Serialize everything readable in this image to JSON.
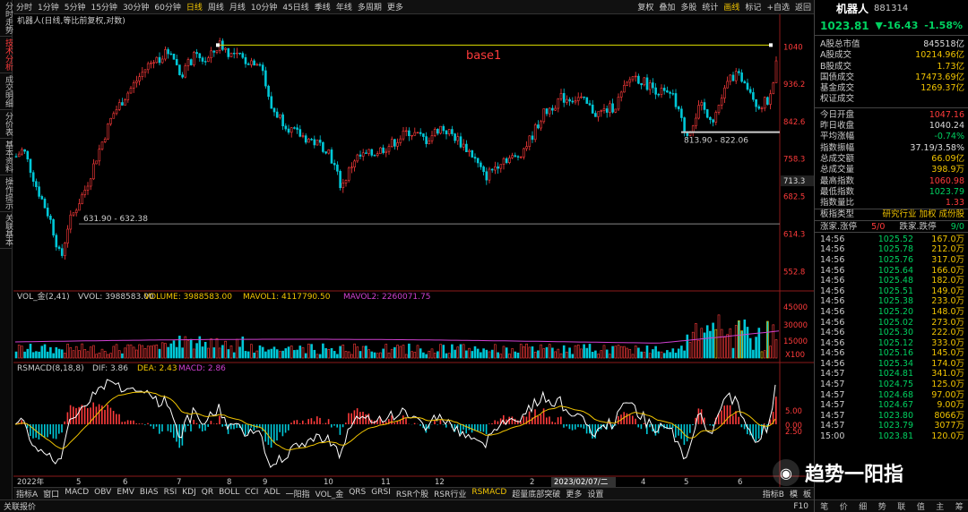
{
  "left_nav": [
    {
      "label": "分时走势",
      "active": false
    },
    {
      "label": "技术分析",
      "active": true
    },
    {
      "label": "成交明细",
      "active": false
    },
    {
      "label": "分价表",
      "active": false
    },
    {
      "label": "基本资料",
      "active": false
    },
    {
      "label": "操作提示",
      "active": false
    },
    {
      "label": "关联基本",
      "active": false
    }
  ],
  "periods": [
    {
      "label": "分时",
      "active": false
    },
    {
      "label": "1分钟",
      "active": false
    },
    {
      "label": "5分钟",
      "active": false
    },
    {
      "label": "15分钟",
      "active": false
    },
    {
      "label": "30分钟",
      "active": false
    },
    {
      "label": "60分钟",
      "active": false
    },
    {
      "label": "日线",
      "active": true
    },
    {
      "label": "周线",
      "active": false
    },
    {
      "label": "月线",
      "active": false
    },
    {
      "label": "10分钟",
      "active": false
    },
    {
      "label": "45日线",
      "active": false
    },
    {
      "label": "季线",
      "active": false
    },
    {
      "label": "年线",
      "active": false
    },
    {
      "label": "多周期",
      "active": false
    },
    {
      "label": "更多",
      "active": false
    }
  ],
  "tools": [
    {
      "label": "复权",
      "active": false
    },
    {
      "label": "叠加",
      "active": false
    },
    {
      "label": "多股",
      "active": false
    },
    {
      "label": "统计",
      "active": false
    },
    {
      "label": "画线",
      "active": true
    },
    {
      "label": "标记",
      "active": false
    },
    {
      "label": "+自选",
      "active": false
    },
    {
      "label": "返回",
      "active": false
    }
  ],
  "chart": {
    "title": "机器人(日线,等比前复权,对数)",
    "annotation": "base1",
    "price_ticks": [
      "1040",
      "936.2",
      "842.6",
      "758.3",
      "682.5",
      "614.3",
      "552.8"
    ],
    "current_tag": "713.3",
    "level_labels": [
      "813.90 - 822.06",
      "631.90 - 632.38"
    ],
    "vol_caption": {
      "name": "VOL_金(2,41)",
      "vvol": "VVOL: 3988583.00",
      "volume": "VOLUME: 3988583.00",
      "mavol1": "MAVOL1: 4117790.50",
      "mavol2": "MAVOL2: 2260071.75"
    },
    "vol_ticks": [
      "45000",
      "30000",
      "15000"
    ],
    "vol_unit": "X100",
    "macd_caption": {
      "name": "RSMACD(8,18,8)",
      "dif": "DIF: 3.86",
      "dea": "DEA: 2.43",
      "macd": "MACD: 2.86"
    },
    "macd_ticks": [
      "5.00",
      "2.50",
      "0.00"
    ],
    "date_ticks": [
      "2022年",
      "5",
      "6",
      "7",
      "8",
      "9",
      "10",
      "11",
      "12",
      "2",
      "4",
      "5",
      "6"
    ],
    "cursor_date": "2023/02/07/二",
    "colors": {
      "up": "#ff3b3b",
      "down": "#00c8d8",
      "dif": "#ffffff",
      "dea": "#f2c500",
      "mavol2": "#d040d0",
      "base_line": "#e0e000"
    }
  },
  "indicator_tabs": [
    {
      "label": "指标A",
      "active": false
    },
    {
      "label": "窗口",
      "active": false
    },
    {
      "label": "MACD",
      "active": false
    },
    {
      "label": "OBV",
      "active": false
    },
    {
      "label": "EMV",
      "active": false
    },
    {
      "label": "BIAS",
      "active": false
    },
    {
      "label": "RSI",
      "active": false
    },
    {
      "label": "KDJ",
      "active": false
    },
    {
      "label": "QR",
      "active": false
    },
    {
      "label": "BOLL",
      "active": false
    },
    {
      "label": "CCI",
      "active": false
    },
    {
      "label": "ADL",
      "active": false
    },
    {
      "label": "一阳指",
      "active": false
    },
    {
      "label": "VOL_金",
      "active": false
    },
    {
      "label": "QRS",
      "active": false
    },
    {
      "label": "GRSI",
      "active": false
    },
    {
      "label": "RSR个股",
      "active": false
    },
    {
      "label": "RSR行业",
      "active": false
    },
    {
      "label": "RSMACD",
      "active": true
    },
    {
      "label": "超量底部突破",
      "active": false
    },
    {
      "label": "更多",
      "active": false
    },
    {
      "label": "设置",
      "active": false
    }
  ],
  "indicator_right": [
    "指标B",
    "模",
    "板"
  ],
  "status": {
    "left": "关联报价",
    "right": "F10"
  },
  "stock": {
    "name": "机器人",
    "code": "881314",
    "price": "1023.81",
    "change": "▼-16.43",
    "pct": "-1.58%"
  },
  "stats_a": [
    {
      "label": "A股总市值",
      "value": "845518亿",
      "color": "white"
    },
    {
      "label": "A股成交",
      "value": "10214.96亿",
      "color": "yellow"
    },
    {
      "label": "B股成交",
      "value": "1.73亿",
      "color": "yellow"
    },
    {
      "label": "国债成交",
      "value": "17473.69亿",
      "color": "yellow"
    },
    {
      "label": "基金成交",
      "value": "1269.37亿",
      "color": "yellow"
    },
    {
      "label": "权证成交",
      "value": "",
      "color": "yellow"
    }
  ],
  "stats_b": [
    {
      "label": "今日开盘",
      "value": "1047.16",
      "color": "red"
    },
    {
      "label": "昨日收盘",
      "value": "1040.24",
      "color": "white"
    },
    {
      "label": "平均涨幅",
      "value": "-0.74%",
      "color": "green"
    },
    {
      "label": "指数振幅",
      "value": "37.19/3.58%",
      "color": "white"
    },
    {
      "label": "总成交额",
      "value": "66.09亿",
      "color": "yellow"
    },
    {
      "label": "总成交量",
      "value": "398.9万",
      "color": "yellow"
    },
    {
      "label": "最高指数",
      "value": "1060.98",
      "color": "red"
    },
    {
      "label": "最低指数",
      "value": "1023.79",
      "color": "green"
    },
    {
      "label": "指数量比",
      "value": "1.33",
      "color": "red"
    }
  ],
  "sector": {
    "label": "板指类型",
    "value": "研究行业 加权 成份股"
  },
  "updown": {
    "up_label": "涨家.涨停",
    "up_value": "5/0",
    "down_label": "跌家.跌停",
    "down_value": "9/0"
  },
  "ticks": [
    {
      "t": "14:56",
      "p": "1025.52",
      "v": "167.0万"
    },
    {
      "t": "14:56",
      "p": "1025.78",
      "v": "212.0万"
    },
    {
      "t": "14:56",
      "p": "1025.76",
      "v": "317.0万"
    },
    {
      "t": "14:56",
      "p": "1025.64",
      "v": "166.0万"
    },
    {
      "t": "14:56",
      "p": "1025.48",
      "v": "182.0万"
    },
    {
      "t": "14:56",
      "p": "1025.51",
      "v": "149.0万"
    },
    {
      "t": "14:56",
      "p": "1025.38",
      "v": "233.0万"
    },
    {
      "t": "14:56",
      "p": "1025.20",
      "v": "148.0万"
    },
    {
      "t": "14:56",
      "p": "1025.02",
      "v": "273.0万"
    },
    {
      "t": "14:56",
      "p": "1025.30",
      "v": "222.0万"
    },
    {
      "t": "14:56",
      "p": "1025.12",
      "v": "333.0万"
    },
    {
      "t": "14:56",
      "p": "1025.16",
      "v": "145.0万"
    },
    {
      "t": "14:56",
      "p": "1025.34",
      "v": "174.0万"
    },
    {
      "t": "14:57",
      "p": "1024.81",
      "v": "341.0万"
    },
    {
      "t": "14:57",
      "p": "1024.75",
      "v": "125.0万"
    },
    {
      "t": "14:57",
      "p": "1024.68",
      "v": "97.00万"
    },
    {
      "t": "14:57",
      "p": "1024.67",
      "v": "9.00万"
    },
    {
      "t": "14:57",
      "p": "1023.80",
      "v": "8066万"
    },
    {
      "t": "14:57",
      "p": "1023.79",
      "v": "3077万"
    },
    {
      "t": "15:00",
      "p": "1023.81",
      "v": "120.0万"
    }
  ],
  "rp_bottom": [
    "笔",
    "价",
    "细",
    "势",
    "联",
    "值",
    "主",
    "筹"
  ],
  "watermark": {
    "icon": "wechat-icon",
    "text": "趋势一阳指"
  }
}
